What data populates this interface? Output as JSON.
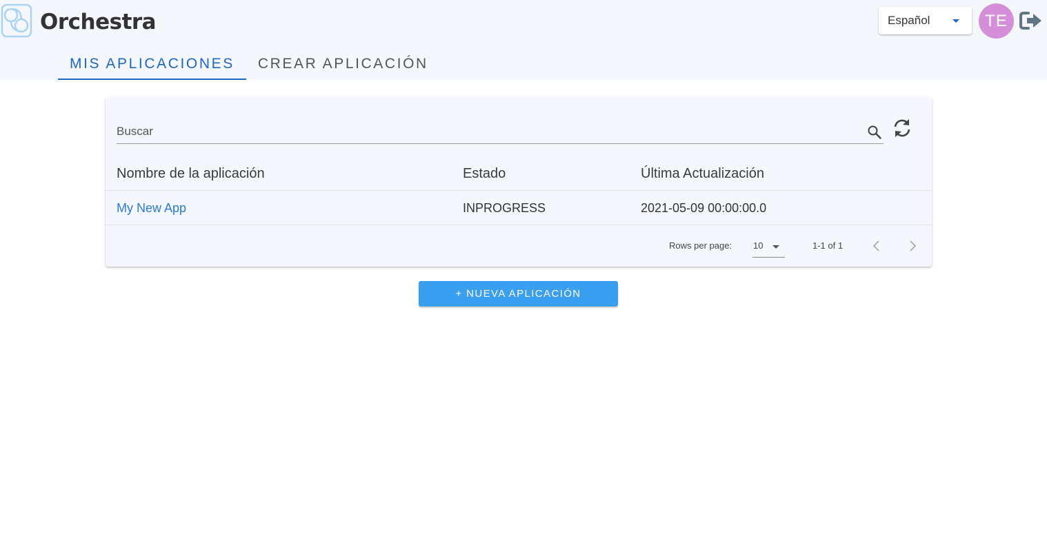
{
  "header": {
    "app_title": "Orchestra",
    "language_selected": "Español",
    "avatar_initials": "TE",
    "icons": {
      "logo": "orchestra-logo-icon",
      "logout": "logout-icon"
    }
  },
  "tabs": [
    {
      "label": "MIS APLICACIONES",
      "active": true
    },
    {
      "label": "CREAR APLICACIÓN",
      "active": false
    }
  ],
  "search": {
    "placeholder": "Buscar",
    "value": ""
  },
  "table": {
    "columns": [
      "Nombre de la aplicación",
      "Estado",
      "Última Actualización"
    ],
    "rows": [
      {
        "name": "My New App",
        "status": "INPROGRESS",
        "updated": "2021-05-09 00:00:00.0"
      }
    ]
  },
  "pagination": {
    "rows_per_page_label": "Rows per page:",
    "rows_per_page": "10",
    "range": "1-1 of 1"
  },
  "new_app_button": "+ NUEVA APLICACIÓN",
  "colors": {
    "accent": "#1e66c8",
    "button": "#3b9ff0",
    "link": "#2a7ad6",
    "avatar": "#d48fd8",
    "header_bg": "#f4f7fb"
  }
}
